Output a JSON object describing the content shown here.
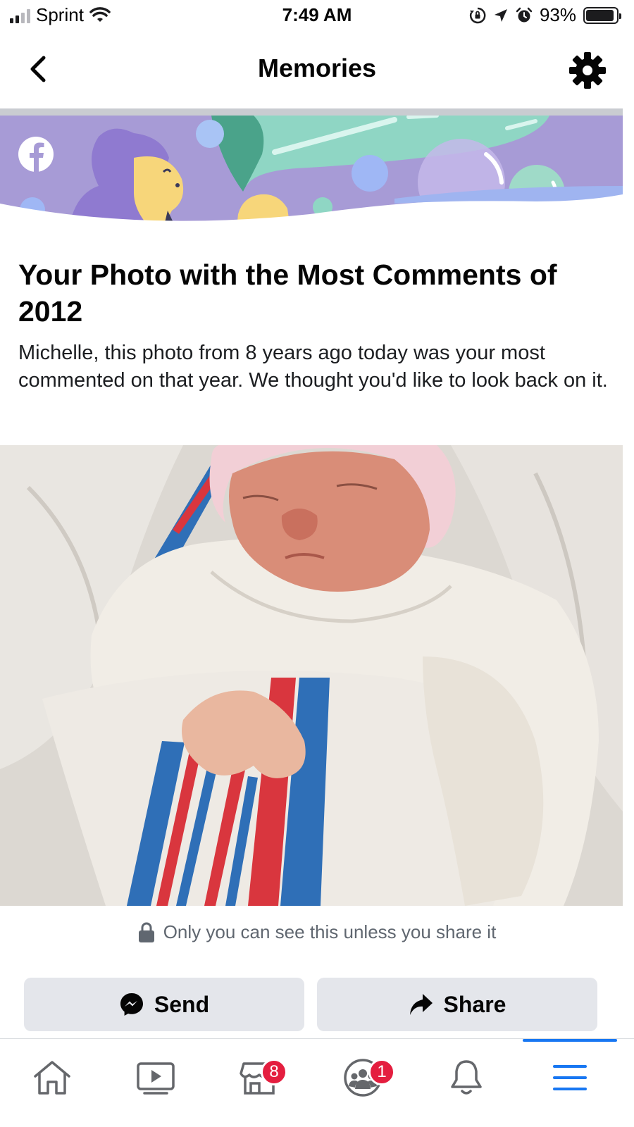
{
  "status_bar": {
    "carrier": "Sprint",
    "time": "7:49 AM",
    "battery_percent": "93%",
    "battery_level": 0.93,
    "icons": [
      "signal-icon",
      "wifi-icon",
      "orientation-lock-icon",
      "location-icon",
      "alarm-icon",
      "battery-icon"
    ]
  },
  "header": {
    "title": "Memories",
    "back_icon": "chevron-left-icon",
    "settings_icon": "gear-icon"
  },
  "banner": {
    "logo_icon": "facebook-logo-icon",
    "colors": {
      "background": "#a79bd6",
      "wave": "#9fb4f0",
      "ribbon": "#8fd6c4"
    }
  },
  "memory": {
    "title": "Your Photo with the Most Comments of 2012",
    "description": "Michelle, this photo from 8 years ago today was your most commented on that year. We thought you'd like to look back on it.",
    "privacy_note": "Only you can see this unless you share it"
  },
  "actions": {
    "send_label": "Send",
    "share_label": "Share"
  },
  "tab_bar": {
    "active_tab": "menu",
    "accent_color": "#1877f2",
    "tabs": [
      {
        "id": "home",
        "icon": "home-icon"
      },
      {
        "id": "watch",
        "icon": "video-icon"
      },
      {
        "id": "marketplace",
        "icon": "marketplace-icon",
        "badge": "8"
      },
      {
        "id": "groups",
        "icon": "groups-icon",
        "badge": "1"
      },
      {
        "id": "notifications",
        "icon": "bell-icon"
      },
      {
        "id": "menu",
        "icon": "menu-icon"
      }
    ]
  }
}
